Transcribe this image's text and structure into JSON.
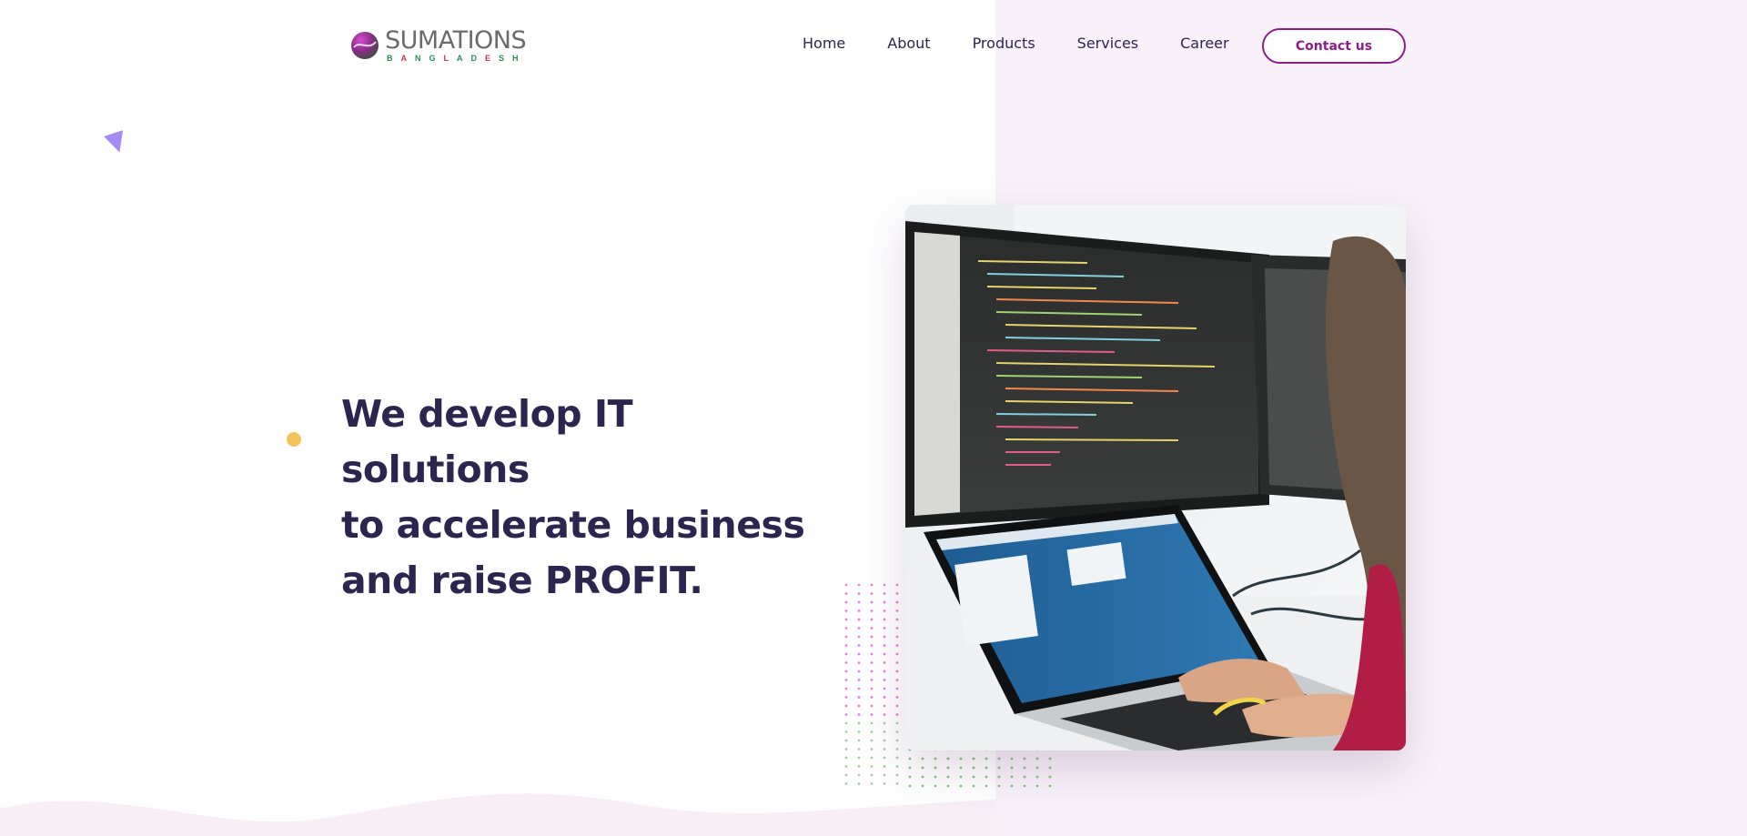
{
  "brand": {
    "name": "SUMATIONS",
    "tagline": "BANGLADESH"
  },
  "nav": {
    "items": [
      "Home",
      "About",
      "Products",
      "Services",
      "Career"
    ],
    "cta": "Contact us"
  },
  "hero": {
    "headline_line1": "We develop IT solutions",
    "headline_line2": "to accelerate business",
    "headline_line3": "and raise PROFIT."
  },
  "colors": {
    "accent": "#8e1d8a",
    "heading": "#2b2550",
    "tint": "#f9f1fa",
    "yellow": "#f5c35b",
    "triangle": "#a78bf5"
  },
  "icons": {
    "logo": "globe-logo-icon",
    "hero_image": "developer-workspace-photo"
  }
}
